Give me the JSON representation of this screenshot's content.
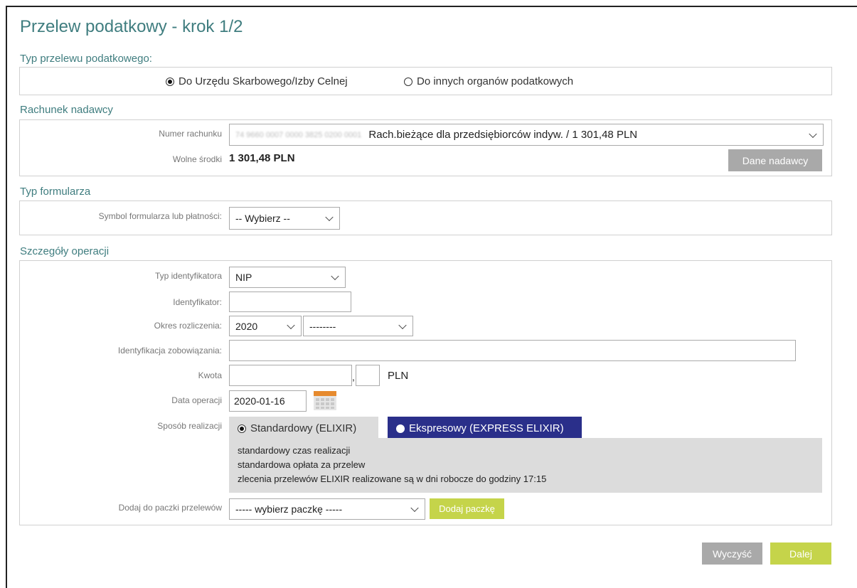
{
  "page": {
    "title": "Przelew podatkowy - krok 1/2"
  },
  "transfer_type": {
    "heading": "Typ przelewu podatkowego:",
    "options": [
      {
        "label": "Do Urzędu Skarbowego/Izby Celnej",
        "selected": true
      },
      {
        "label": "Do innych organów podatkowych",
        "selected": false
      }
    ]
  },
  "sender": {
    "heading": "Rachunek nadawcy",
    "account_label": "Numer rachunku",
    "account_masked": "74 9660 0007 0000 3825 0200 0001",
    "account_value": "Rach.bieżące dla przedsiębiorców indyw. / 1 301,48 PLN",
    "funds_label": "Wolne środki",
    "funds_value": "1 301,48 PLN",
    "sender_data_button": "Dane nadawcy"
  },
  "form_type": {
    "heading": "Typ formularza",
    "symbol_label": "Symbol formularza lub płatności:",
    "symbol_value": "-- Wybierz --"
  },
  "details": {
    "heading": "Szczegóły operacji",
    "id_type_label": "Typ identyfikatora",
    "id_type_value": "NIP",
    "identifier_label": "Identyfikator:",
    "identifier_value": "",
    "period_label": "Okres rozliczenia:",
    "period_year": "2020",
    "period_sub": "--------",
    "obligation_label": "Identyfikacja zobowiązania:",
    "obligation_value": "",
    "amount_label": "Kwota",
    "amount_whole": "",
    "amount_sep": ",",
    "amount_cents": "",
    "currency": "PLN",
    "date_label": "Data operacji",
    "date_value": "2020-01-16",
    "method_label": "Sposób realizacji",
    "methods": [
      {
        "label": "Standardowy (ELIXIR)",
        "selected": true
      },
      {
        "label": "Ekspresowy (EXPRESS ELIXIR)",
        "selected": false
      }
    ],
    "method_info": [
      "standardowy czas realizacji",
      "standardowa opłata za przelew",
      "zlecenia przelewów ELIXIR realizowane są w dni robocze do godziny 17:15"
    ],
    "package_label": "Dodaj do paczki przelewów",
    "package_value": "----- wybierz paczkę -----",
    "add_package_button": "Dodaj paczkę"
  },
  "actions": {
    "clear": "Wyczyść",
    "next": "Dalej"
  },
  "colors": {
    "heading": "#3f7d7f",
    "express": "#2a2f8a",
    "lime": "#c5d44a",
    "gray_button": "#a9a9a9"
  }
}
